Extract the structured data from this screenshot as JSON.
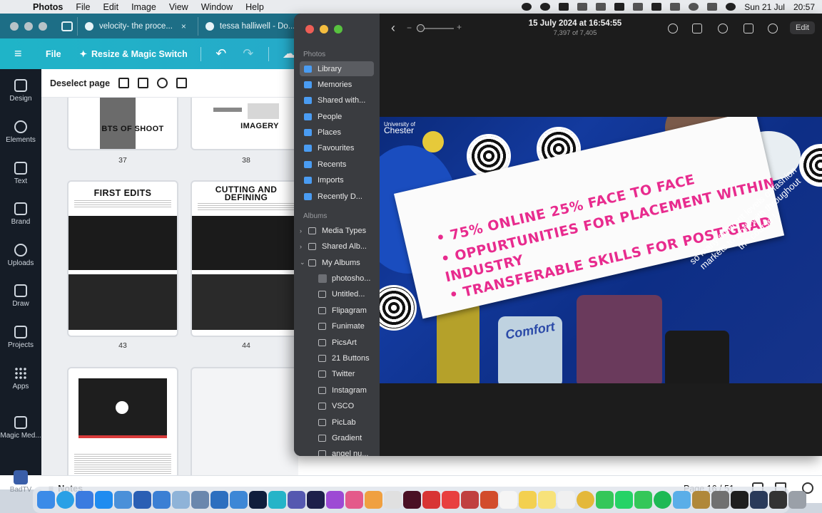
{
  "menubar": {
    "app_name": "Photos",
    "items": [
      "File",
      "Edit",
      "Image",
      "View",
      "Window",
      "Help"
    ],
    "date": "Sun 21 Jul",
    "time": "20:57"
  },
  "browser": {
    "tabs": [
      {
        "title": "velocity- the proce..."
      },
      {
        "title": "tessa halliwell - Do..."
      }
    ]
  },
  "canva": {
    "toolbar": {
      "file": "File",
      "resize": "Resize & Magic Switch"
    },
    "action_bar": {
      "deselect": "Deselect page"
    },
    "sidebar": [
      "Design",
      "Elements",
      "Text",
      "Brand",
      "Uploads",
      "Draw",
      "Projects",
      "Apps",
      "Magic Med..."
    ],
    "badtv": "BadTV",
    "pages": [
      {
        "num": "37",
        "title": "BTS OF SHOOT"
      },
      {
        "num": "38",
        "title": "IMAGERY"
      },
      {
        "num": "43",
        "title": "FIRST EDITS"
      },
      {
        "num": "44",
        "title": "CUTTING AND DEFINING"
      },
      {
        "num": "",
        "title": ""
      },
      {
        "num": "",
        "title": ""
      }
    ],
    "footer": {
      "notes": "Notes",
      "page_indicator": "Page 16 / 51"
    },
    "colors": {
      "toolbar_start": "#1fb4c8",
      "toolbar_end": "#7a6ae0",
      "sidebar": "#151c26"
    }
  },
  "photos": {
    "sidebar_header": "Photos",
    "library": [
      {
        "label": "Library",
        "icon": "library-icon"
      },
      {
        "label": "Memories",
        "icon": "memories-icon"
      },
      {
        "label": "Shared with...",
        "icon": "shared-icon"
      },
      {
        "label": "People",
        "icon": "people-icon"
      },
      {
        "label": "Places",
        "icon": "places-icon"
      },
      {
        "label": "Favourites",
        "icon": "heart-icon"
      },
      {
        "label": "Recents",
        "icon": "clock-icon"
      },
      {
        "label": "Imports",
        "icon": "import-icon"
      },
      {
        "label": "Recently D...",
        "icon": "trash-icon"
      }
    ],
    "albums_header": "Albums",
    "albums": [
      {
        "label": "Media Types"
      },
      {
        "label": "Shared Alb..."
      },
      {
        "label": "My Albums"
      },
      {
        "label": "photosho..."
      },
      {
        "label": "Untitled..."
      },
      {
        "label": "Flipagram"
      },
      {
        "label": "Funimate"
      },
      {
        "label": "PicsArt"
      },
      {
        "label": "21 Buttons"
      },
      {
        "label": "Twitter"
      },
      {
        "label": "Instagram"
      },
      {
        "label": "VSCO"
      },
      {
        "label": "PicLab"
      },
      {
        "label": "Gradient"
      },
      {
        "label": "angel nu..."
      }
    ],
    "viewer": {
      "date": "15 July 2024 at 16:54:55",
      "count": "7,397 of 7,405",
      "edit": "Edit"
    },
    "image": {
      "logo_line1": "University of",
      "logo_line2": "Chester",
      "bullets": [
        "• 75% ONLINE 25% FACE TO FACE",
        "• OPPURTUNITIES  FOR  PLACEMENT  WITHIN",
        "  INDUSTRY",
        "• TRANSFERABLE SKILLS FOR POST-GRAD"
      ],
      "side_text": "so many different levels of fashion markets to work with throughout the course !",
      "brand": "Comfort"
    }
  }
}
